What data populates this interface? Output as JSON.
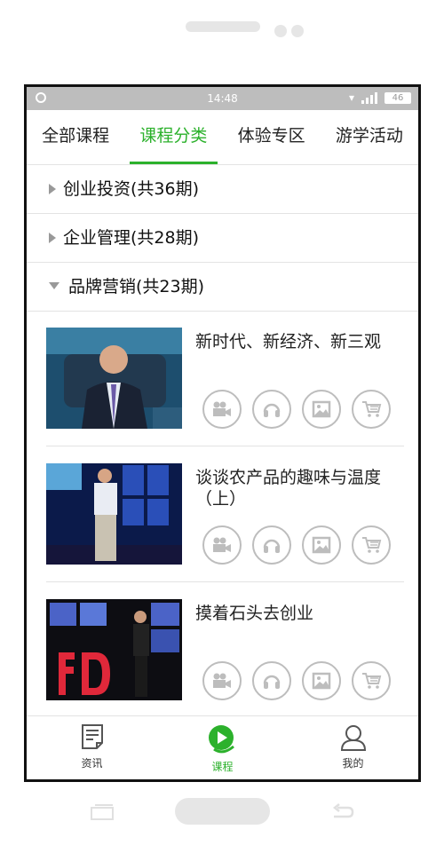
{
  "status": {
    "time": "14:48",
    "battery": "46"
  },
  "tabs": [
    {
      "label": "全部课程",
      "active": false
    },
    {
      "label": "课程分类",
      "active": true
    },
    {
      "label": "体验专区",
      "active": false
    },
    {
      "label": "游学活动",
      "active": false
    }
  ],
  "categories": [
    {
      "label": "创业投资(共36期)",
      "expanded": false
    },
    {
      "label": "企业管理(共28期)",
      "expanded": false
    },
    {
      "label": "品牌营销(共23期)",
      "expanded": true
    }
  ],
  "courses": [
    {
      "title": "新时代、新经济、新三观"
    },
    {
      "title": "谈谈农产品的趣味与温度（上）"
    },
    {
      "title": "摸着石头去创业"
    }
  ],
  "course_actions": [
    "video-icon",
    "audio-icon",
    "image-icon",
    "cart-icon"
  ],
  "bottom_nav": [
    {
      "label": "资讯",
      "icon": "news-icon",
      "active": false
    },
    {
      "label": "课程",
      "icon": "course-play-icon",
      "active": true
    },
    {
      "label": "我的",
      "icon": "profile-icon",
      "active": false
    }
  ],
  "colors": {
    "accent": "#2cb12c",
    "statusbar": "#bdbdbd"
  }
}
